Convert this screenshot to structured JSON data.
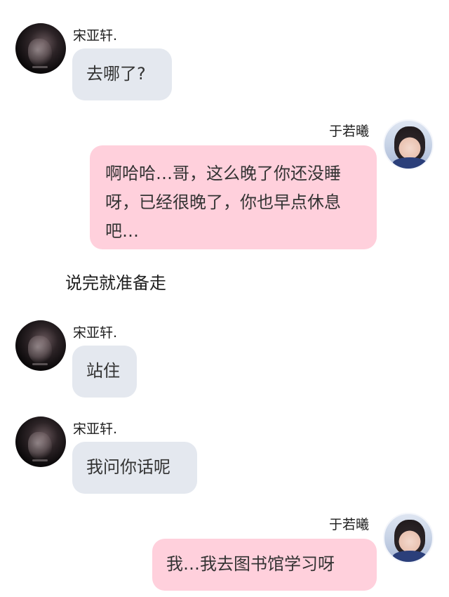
{
  "messages": [
    {
      "sender": "宋亚轩.",
      "text": "去哪了?",
      "avatar": "dark-portrait-avatar"
    },
    {
      "sender": "于若曦",
      "text": "啊哈哈…哥，这么晚了你还没睡呀，已经很晚了，你也早点休息吧…",
      "avatar": "girl-selfie-avatar"
    },
    {
      "sender": "宋亚轩.",
      "text": "站住",
      "avatar": "dark-portrait-avatar"
    },
    {
      "sender": "宋亚轩.",
      "text": "我问你话呢",
      "avatar": "dark-portrait-avatar"
    },
    {
      "sender": "于若曦",
      "text": "我…我去图书馆学习呀",
      "avatar": "girl-selfie-avatar"
    }
  ],
  "narration": "说完就准备走",
  "colors": {
    "left_bubble": "#e4e8ef",
    "right_bubble": "#ffd0dc",
    "background": "#ffffff"
  }
}
